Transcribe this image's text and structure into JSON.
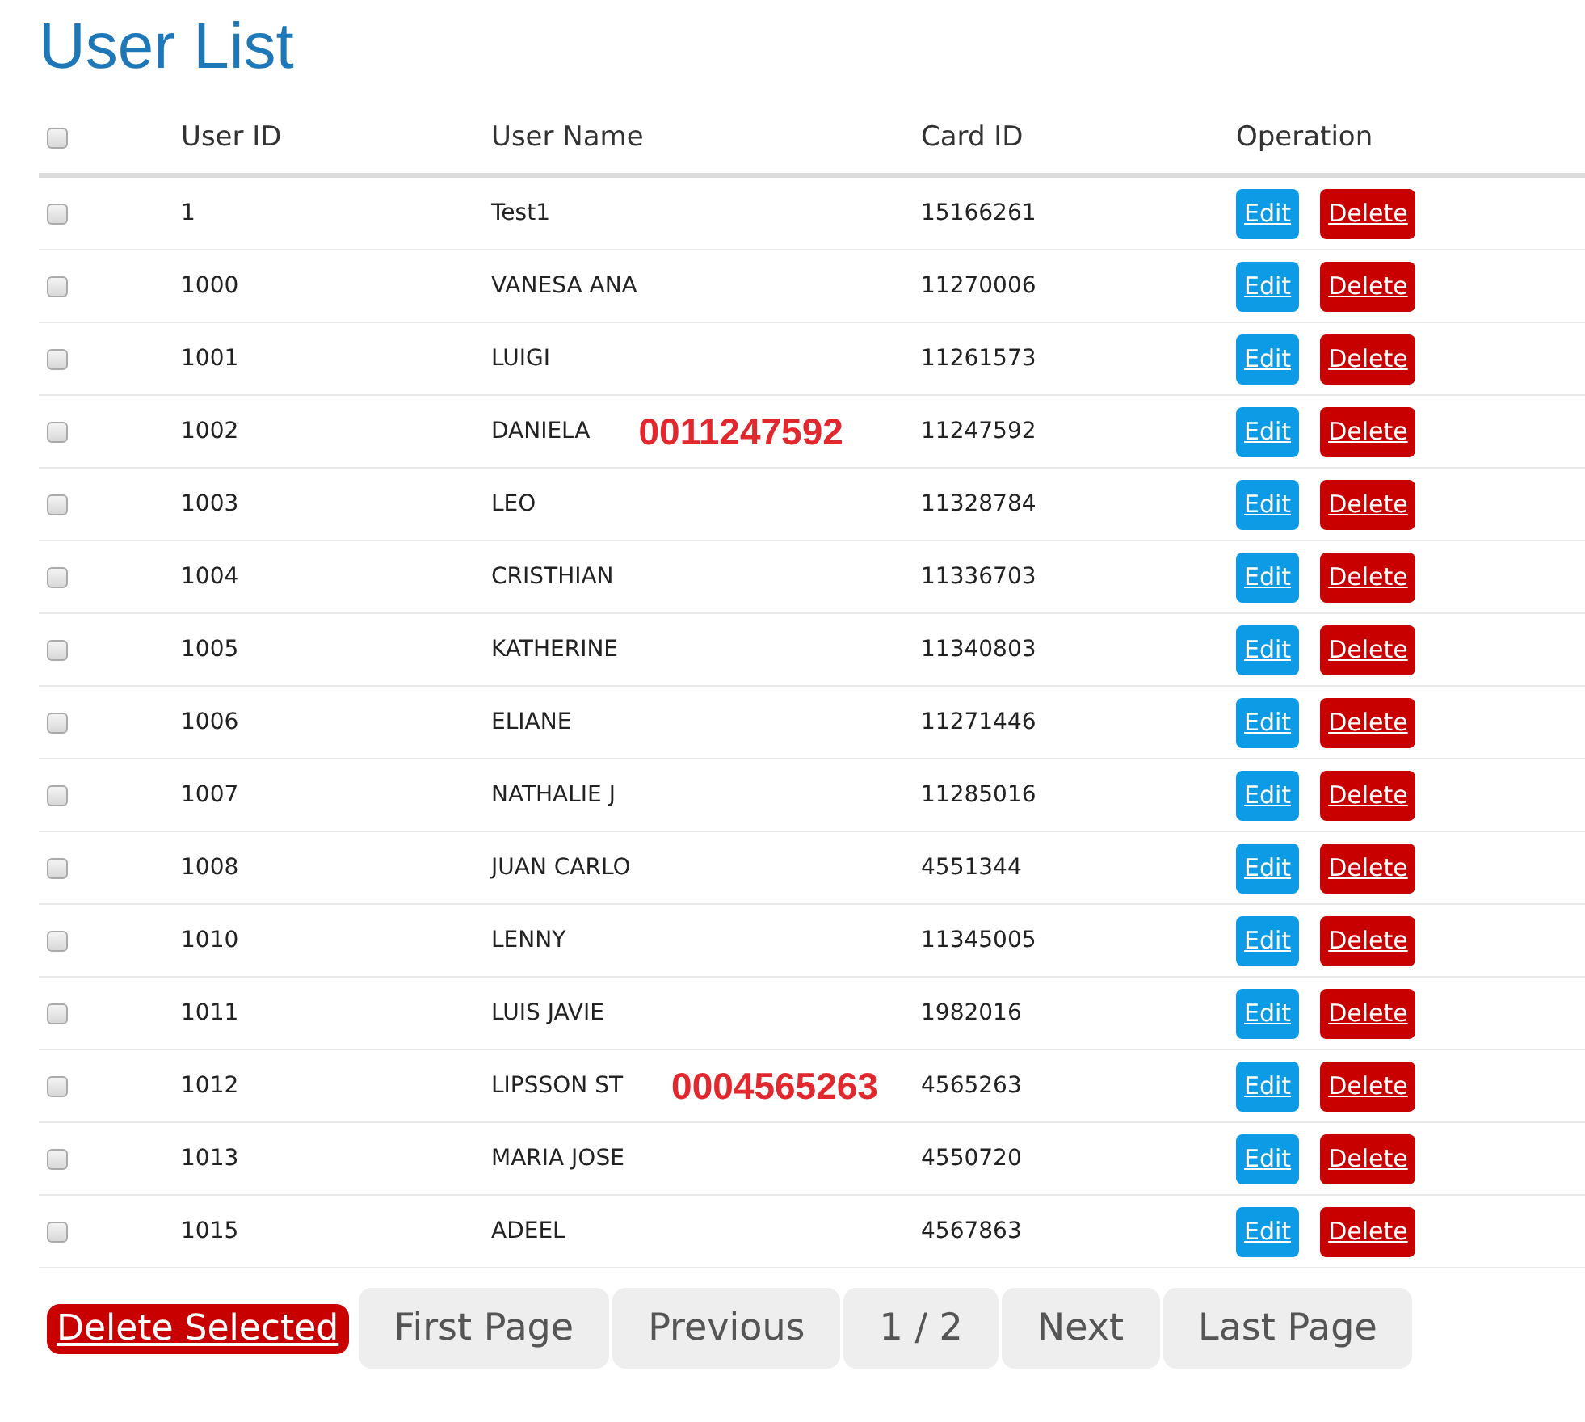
{
  "title": "User List",
  "table": {
    "select_all": {
      "checked": false
    },
    "columns": [
      "User ID",
      "User Name",
      "Card ID",
      "Operation"
    ],
    "rows": [
      {
        "checked": false,
        "user_id": "1",
        "user_name": "Test1",
        "card_id": "15166261",
        "actions": [
          "Edit",
          "Delete"
        ]
      },
      {
        "checked": false,
        "user_id": "1000",
        "user_name": "VANESA ANA",
        "card_id": "11270006",
        "actions": [
          "Edit",
          "Delete"
        ]
      },
      {
        "checked": false,
        "user_id": "1001",
        "user_name": "LUIGI",
        "card_id": "11261573",
        "actions": [
          "Edit",
          "Delete"
        ]
      },
      {
        "checked": false,
        "user_id": "1002",
        "user_name": "DANIELA",
        "annotation": "0011247592",
        "card_id": "11247592",
        "actions": [
          "Edit",
          "Delete"
        ]
      },
      {
        "checked": false,
        "user_id": "1003",
        "user_name": "LEO",
        "card_id": "11328784",
        "actions": [
          "Edit",
          "Delete"
        ]
      },
      {
        "checked": false,
        "user_id": "1004",
        "user_name": "CRISTHIAN",
        "card_id": "11336703",
        "actions": [
          "Edit",
          "Delete"
        ]
      },
      {
        "checked": false,
        "user_id": "1005",
        "user_name": "KATHERINE",
        "card_id": "11340803",
        "actions": [
          "Edit",
          "Delete"
        ]
      },
      {
        "checked": false,
        "user_id": "1006",
        "user_name": "ELIANE",
        "card_id": "11271446",
        "actions": [
          "Edit",
          "Delete"
        ]
      },
      {
        "checked": false,
        "user_id": "1007",
        "user_name": "NATHALIE J",
        "card_id": "11285016",
        "actions": [
          "Edit",
          "Delete"
        ]
      },
      {
        "checked": false,
        "user_id": "1008",
        "user_name": "JUAN CARLO",
        "card_id": "4551344",
        "actions": [
          "Edit",
          "Delete"
        ]
      },
      {
        "checked": false,
        "user_id": "1010",
        "user_name": "LENNY",
        "card_id": "11345005",
        "actions": [
          "Edit",
          "Delete"
        ]
      },
      {
        "checked": false,
        "user_id": "1011",
        "user_name": "LUIS JAVIE",
        "card_id": "1982016",
        "actions": [
          "Edit",
          "Delete"
        ]
      },
      {
        "checked": false,
        "user_id": "1012",
        "user_name": "LIPSSON ST",
        "annotation": "0004565263",
        "card_id": "4565263",
        "actions": [
          "Edit",
          "Delete"
        ]
      },
      {
        "checked": false,
        "user_id": "1013",
        "user_name": "MARIA JOSE",
        "card_id": "4550720",
        "actions": [
          "Edit",
          "Delete"
        ]
      },
      {
        "checked": false,
        "user_id": "1015",
        "user_name": "ADEEL",
        "card_id": "4567863",
        "actions": [
          "Edit",
          "Delete"
        ]
      }
    ]
  },
  "footer": {
    "delete_selected": "Delete Selected",
    "pager": [
      "First Page",
      "Previous",
      "1 / 2",
      "Next",
      "Last Page"
    ]
  }
}
